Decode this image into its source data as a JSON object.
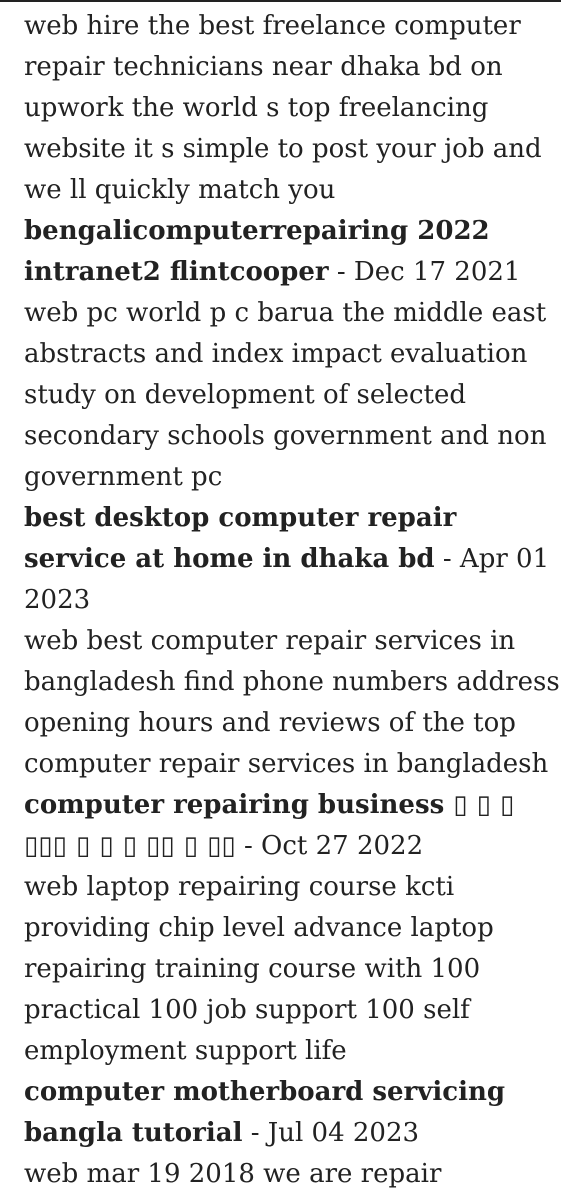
{
  "intro_text": "web hire the best freelance computer repair technicians near dhaka bd on upwork the world s top freelancing website it s simple to post your job and we ll quickly match you",
  "entries": [
    {
      "title": "bengalicomputerrepairing 2022 intranet2 flintcooper",
      "separator": " - ",
      "date": "Dec 17 2021",
      "body": "web pc world p c barua the middle east abstracts and index impact evaluation study on development of selected secondary schools government and non government pc"
    },
    {
      "title": "best desktop computer repair service at home in dhaka bd",
      "separator": " - ",
      "date": "Apr 01 2023",
      "body": "web best computer repair services in bangladesh find phone numbers address opening hours and reviews of the top computer repair services in bangladesh"
    },
    {
      "title": "computer repairing business ▯ ▯ ▯ ▯▯▯ ▯ ▯ ▯ ▯▯ ▯ ▯▯",
      "separator": " - ",
      "date": "Oct 27 2022",
      "body": "web laptop repairing course kcti providing chip level advance laptop repairing training course with 100 practical 100 job support 100 self employment support life"
    },
    {
      "title": "computer motherboard servicing bangla tutorial",
      "separator": " - ",
      "date": "Jul 04 2023",
      "body": "web mar 19 2018  we are repair"
    }
  ]
}
